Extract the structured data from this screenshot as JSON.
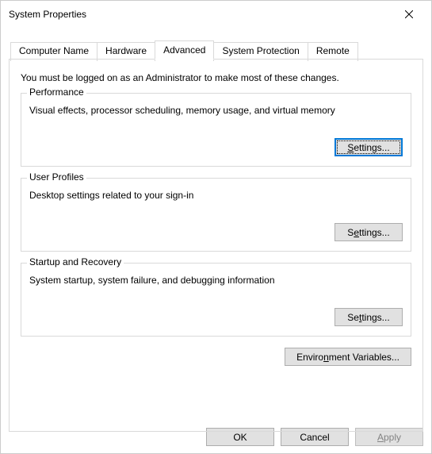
{
  "titlebar": {
    "title": "System Properties"
  },
  "tabs": {
    "computer_name": "Computer Name",
    "hardware": "Hardware",
    "advanced": "Advanced",
    "system_protection": "System Protection",
    "remote": "Remote"
  },
  "panel": {
    "admin_note": "You must be logged on as an Administrator to make most of these changes.",
    "performance": {
      "title": "Performance",
      "desc": "Visual effects, processor scheduling, memory usage, and virtual memory",
      "button_prefix": "S",
      "button_rest": "ettings..."
    },
    "user_profiles": {
      "title": "User Profiles",
      "desc": "Desktop settings related to your sign-in",
      "button_prefix": "S",
      "button_rest": "ettings..."
    },
    "startup_recovery": {
      "title": "Startup and Recovery",
      "desc": "System startup, system failure, and debugging information",
      "button_prefix": "Se",
      "button_rest": "ttings..."
    },
    "env_vars": {
      "button_prefix": "Enviro",
      "button_rest": "nment Variables..."
    }
  },
  "footer": {
    "ok": "OK",
    "cancel": "Cancel",
    "apply_prefix": "A",
    "apply_rest": "pply"
  }
}
